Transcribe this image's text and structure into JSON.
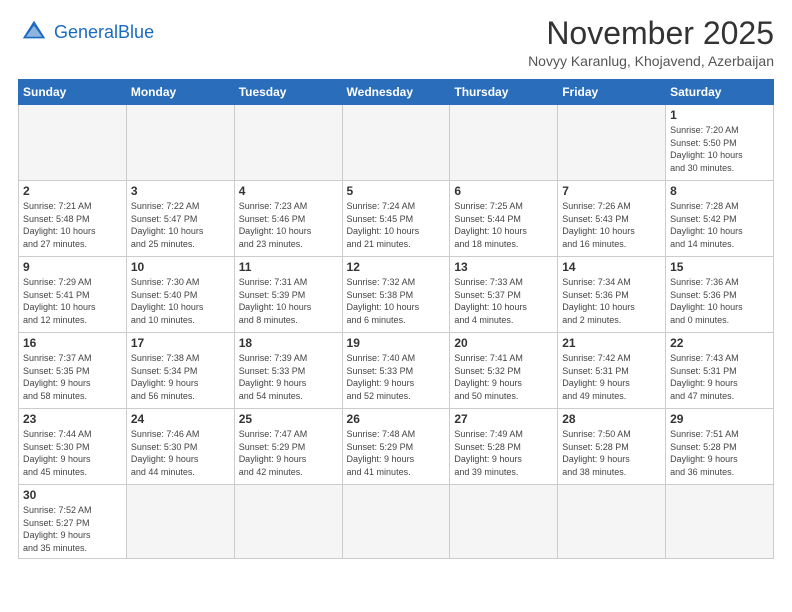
{
  "header": {
    "logo_general": "General",
    "logo_blue": "Blue",
    "month_title": "November 2025",
    "location": "Novyy Karanlug, Khojavend, Azerbaijan"
  },
  "days_of_week": [
    "Sunday",
    "Monday",
    "Tuesday",
    "Wednesday",
    "Thursday",
    "Friday",
    "Saturday"
  ],
  "weeks": [
    [
      {
        "num": "",
        "info": ""
      },
      {
        "num": "",
        "info": ""
      },
      {
        "num": "",
        "info": ""
      },
      {
        "num": "",
        "info": ""
      },
      {
        "num": "",
        "info": ""
      },
      {
        "num": "",
        "info": ""
      },
      {
        "num": "1",
        "info": "Sunrise: 7:20 AM\nSunset: 5:50 PM\nDaylight: 10 hours\nand 30 minutes."
      }
    ],
    [
      {
        "num": "2",
        "info": "Sunrise: 7:21 AM\nSunset: 5:48 PM\nDaylight: 10 hours\nand 27 minutes."
      },
      {
        "num": "3",
        "info": "Sunrise: 7:22 AM\nSunset: 5:47 PM\nDaylight: 10 hours\nand 25 minutes."
      },
      {
        "num": "4",
        "info": "Sunrise: 7:23 AM\nSunset: 5:46 PM\nDaylight: 10 hours\nand 23 minutes."
      },
      {
        "num": "5",
        "info": "Sunrise: 7:24 AM\nSunset: 5:45 PM\nDaylight: 10 hours\nand 21 minutes."
      },
      {
        "num": "6",
        "info": "Sunrise: 7:25 AM\nSunset: 5:44 PM\nDaylight: 10 hours\nand 18 minutes."
      },
      {
        "num": "7",
        "info": "Sunrise: 7:26 AM\nSunset: 5:43 PM\nDaylight: 10 hours\nand 16 minutes."
      },
      {
        "num": "8",
        "info": "Sunrise: 7:28 AM\nSunset: 5:42 PM\nDaylight: 10 hours\nand 14 minutes."
      }
    ],
    [
      {
        "num": "9",
        "info": "Sunrise: 7:29 AM\nSunset: 5:41 PM\nDaylight: 10 hours\nand 12 minutes."
      },
      {
        "num": "10",
        "info": "Sunrise: 7:30 AM\nSunset: 5:40 PM\nDaylight: 10 hours\nand 10 minutes."
      },
      {
        "num": "11",
        "info": "Sunrise: 7:31 AM\nSunset: 5:39 PM\nDaylight: 10 hours\nand 8 minutes."
      },
      {
        "num": "12",
        "info": "Sunrise: 7:32 AM\nSunset: 5:38 PM\nDaylight: 10 hours\nand 6 minutes."
      },
      {
        "num": "13",
        "info": "Sunrise: 7:33 AM\nSunset: 5:37 PM\nDaylight: 10 hours\nand 4 minutes."
      },
      {
        "num": "14",
        "info": "Sunrise: 7:34 AM\nSunset: 5:36 PM\nDaylight: 10 hours\nand 2 minutes."
      },
      {
        "num": "15",
        "info": "Sunrise: 7:36 AM\nSunset: 5:36 PM\nDaylight: 10 hours\nand 0 minutes."
      }
    ],
    [
      {
        "num": "16",
        "info": "Sunrise: 7:37 AM\nSunset: 5:35 PM\nDaylight: 9 hours\nand 58 minutes."
      },
      {
        "num": "17",
        "info": "Sunrise: 7:38 AM\nSunset: 5:34 PM\nDaylight: 9 hours\nand 56 minutes."
      },
      {
        "num": "18",
        "info": "Sunrise: 7:39 AM\nSunset: 5:33 PM\nDaylight: 9 hours\nand 54 minutes."
      },
      {
        "num": "19",
        "info": "Sunrise: 7:40 AM\nSunset: 5:33 PM\nDaylight: 9 hours\nand 52 minutes."
      },
      {
        "num": "20",
        "info": "Sunrise: 7:41 AM\nSunset: 5:32 PM\nDaylight: 9 hours\nand 50 minutes."
      },
      {
        "num": "21",
        "info": "Sunrise: 7:42 AM\nSunset: 5:31 PM\nDaylight: 9 hours\nand 49 minutes."
      },
      {
        "num": "22",
        "info": "Sunrise: 7:43 AM\nSunset: 5:31 PM\nDaylight: 9 hours\nand 47 minutes."
      }
    ],
    [
      {
        "num": "23",
        "info": "Sunrise: 7:44 AM\nSunset: 5:30 PM\nDaylight: 9 hours\nand 45 minutes."
      },
      {
        "num": "24",
        "info": "Sunrise: 7:46 AM\nSunset: 5:30 PM\nDaylight: 9 hours\nand 44 minutes."
      },
      {
        "num": "25",
        "info": "Sunrise: 7:47 AM\nSunset: 5:29 PM\nDaylight: 9 hours\nand 42 minutes."
      },
      {
        "num": "26",
        "info": "Sunrise: 7:48 AM\nSunset: 5:29 PM\nDaylight: 9 hours\nand 41 minutes."
      },
      {
        "num": "27",
        "info": "Sunrise: 7:49 AM\nSunset: 5:28 PM\nDaylight: 9 hours\nand 39 minutes."
      },
      {
        "num": "28",
        "info": "Sunrise: 7:50 AM\nSunset: 5:28 PM\nDaylight: 9 hours\nand 38 minutes."
      },
      {
        "num": "29",
        "info": "Sunrise: 7:51 AM\nSunset: 5:28 PM\nDaylight: 9 hours\nand 36 minutes."
      }
    ],
    [
      {
        "num": "30",
        "info": "Sunrise: 7:52 AM\nSunset: 5:27 PM\nDaylight: 9 hours\nand 35 minutes."
      },
      {
        "num": "",
        "info": ""
      },
      {
        "num": "",
        "info": ""
      },
      {
        "num": "",
        "info": ""
      },
      {
        "num": "",
        "info": ""
      },
      {
        "num": "",
        "info": ""
      },
      {
        "num": "",
        "info": ""
      }
    ]
  ]
}
